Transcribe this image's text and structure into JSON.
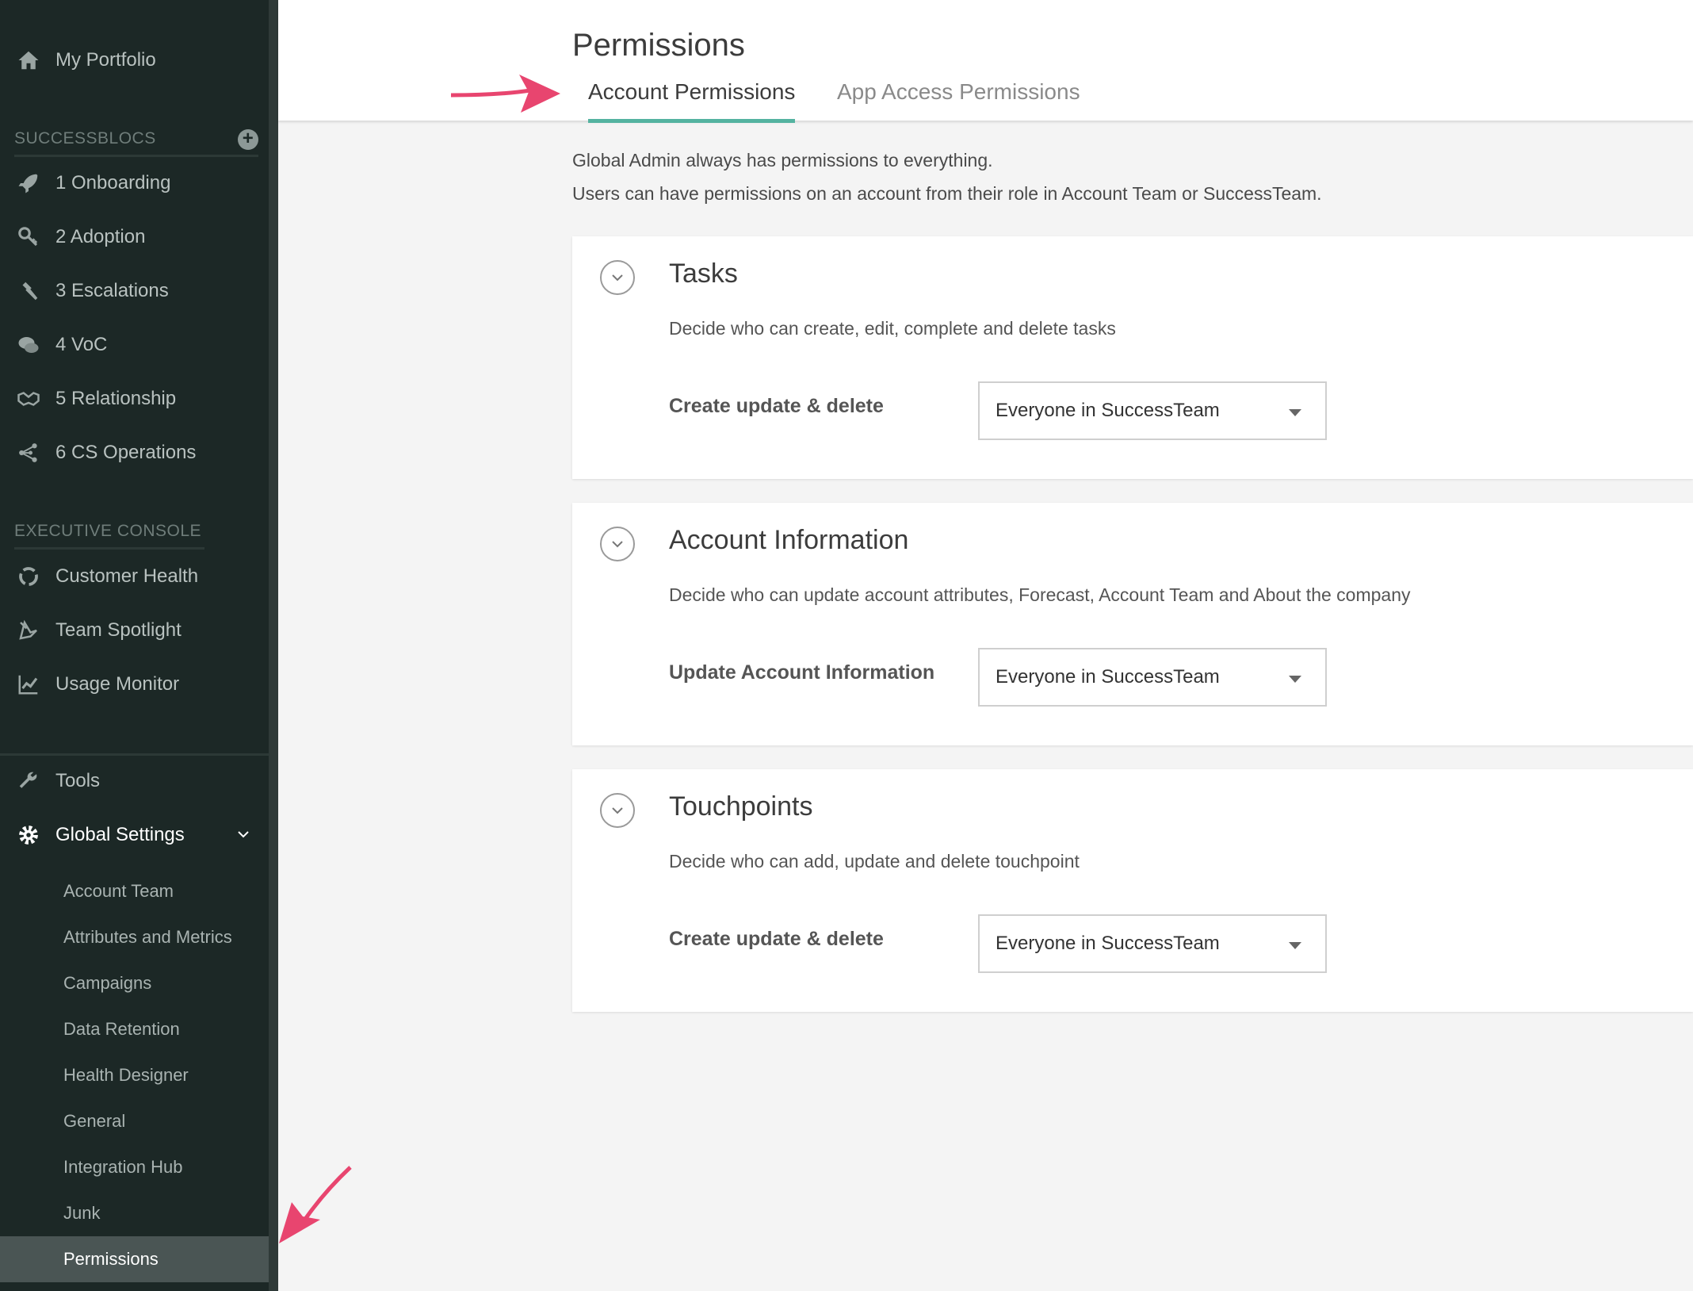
{
  "sidebar": {
    "portfolio": {
      "label": "My Portfolio",
      "icon": "home-icon"
    },
    "successblocs": {
      "heading": "SUCCESSBLOCS",
      "items": [
        {
          "label": "1 Onboarding",
          "icon": "rocket-icon"
        },
        {
          "label": "2 Adoption",
          "icon": "key-icon"
        },
        {
          "label": "3 Escalations",
          "icon": "gavel-icon"
        },
        {
          "label": "4 VoC",
          "icon": "chat-bubbles-icon"
        },
        {
          "label": "5 Relationship",
          "icon": "handshake-icon"
        },
        {
          "label": "6 CS Operations",
          "icon": "share-icon"
        }
      ]
    },
    "executive_console": {
      "heading": "EXECUTIVE CONSOLE",
      "items": [
        {
          "label": "Customer Health",
          "icon": "health-circle-icon"
        },
        {
          "label": "Team Spotlight",
          "icon": "spotlight-icon"
        },
        {
          "label": "Usage Monitor",
          "icon": "line-chart-icon"
        }
      ]
    },
    "tools": {
      "label": "Tools",
      "icon": "wrench-icon"
    },
    "global_settings": {
      "label": "Global Settings",
      "icon": "gear-icon",
      "sub_items": [
        {
          "label": "Account Team"
        },
        {
          "label": "Attributes and Metrics"
        },
        {
          "label": "Campaigns"
        },
        {
          "label": "Data Retention"
        },
        {
          "label": "Health Designer"
        },
        {
          "label": "General"
        },
        {
          "label": "Integration Hub"
        },
        {
          "label": "Junk"
        },
        {
          "label": "Permissions"
        }
      ]
    }
  },
  "header": {
    "title": "Permissions",
    "tabs": [
      {
        "label": "Account Permissions",
        "active": true
      },
      {
        "label": "App Access Permissions",
        "active": false
      }
    ]
  },
  "intro": {
    "line1": "Global Admin always has permissions to everything.",
    "line2": "Users can have permissions on an account from their role in Account Team or SuccessTeam."
  },
  "cards": [
    {
      "title": "Tasks",
      "description": "Decide who can create, edit, complete and delete tasks",
      "row_label": "Create update & delete",
      "select_value": "Everyone in SuccessTeam"
    },
    {
      "title": "Account Information",
      "description": "Decide who can update account attributes, Forecast, Account Team and About the company",
      "row_label": "Update Account Information",
      "select_value": "Everyone in SuccessTeam"
    },
    {
      "title": "Touchpoints",
      "description": "Decide who can add, update and delete touchpoint",
      "row_label": "Create update & delete",
      "select_value": "Everyone in SuccessTeam"
    }
  ],
  "colors": {
    "accent": "#54b3a0",
    "annotation_arrow": "#e8456f",
    "sidebar_bg": "#1c2826"
  }
}
